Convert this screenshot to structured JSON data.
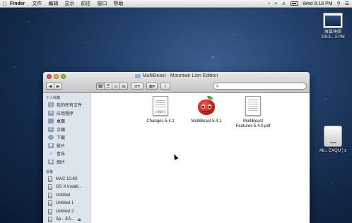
{
  "menubar": {
    "apple_icon": "apple-logo",
    "app_name": "Finder",
    "menus": [
      "文件",
      "编辑",
      "显示",
      "前往",
      "窗口",
      "帮助"
    ],
    "clock": "Wed 8:18 PM"
  },
  "desktop": {
    "screenshot_label_1": "屏幕快照",
    "screenshot_label_2": "2013…3 PM",
    "drive_label": "Ab←EAQU ¦ ±"
  },
  "window": {
    "title": "MultiBeast - Mountain Lion Edition",
    "search_placeholder": "",
    "sidebar": {
      "favorites_header": "个人收藏",
      "favorites": [
        {
          "label": "我的所有文件",
          "icon": "all-files-icon"
        },
        {
          "label": "应用程序",
          "icon": "applications-icon"
        },
        {
          "label": "桌面",
          "icon": "desktop-icon"
        },
        {
          "label": "文稿",
          "icon": "documents-icon"
        },
        {
          "label": "下载",
          "icon": "downloads-icon"
        },
        {
          "label": "影片",
          "icon": "movies-icon"
        },
        {
          "label": "音乐",
          "icon": "music-icon"
        },
        {
          "label": "图片",
          "icon": "pictures-icon"
        }
      ],
      "devices_header": "设备",
      "devices": [
        {
          "label": "MAC 10.8S"
        },
        {
          "label": "OS X Install..."
        },
        {
          "label": "Untitled"
        },
        {
          "label": "Untitled 1"
        },
        {
          "label": "Untitled 2"
        },
        {
          "label": "Àþ←ÈÀ..."
        }
      ]
    },
    "files": [
      {
        "name": "Changes-5.4.1",
        "icon": "text-document-icon"
      },
      {
        "name": "MultiBeast 5.4.1",
        "icon": "multibeast-app-icon"
      },
      {
        "name_line1": "MultiBeast",
        "name_line2": "Features-5.4.0.pdf",
        "icon": "pdf-document-icon"
      }
    ]
  }
}
